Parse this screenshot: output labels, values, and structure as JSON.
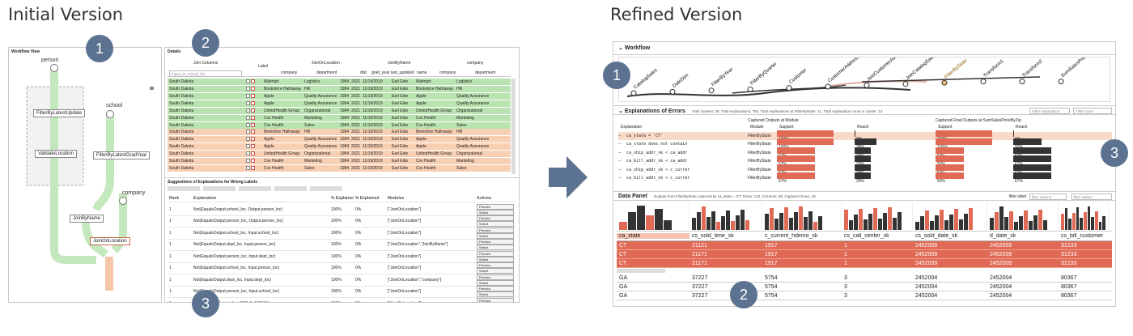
{
  "titles": {
    "initial": "Initial Version",
    "refined": "Refined Version"
  },
  "badges": {
    "w1": "1",
    "w2": "2",
    "w3": "3",
    "r1": "1",
    "r2": "2",
    "r3": "3"
  },
  "initial": {
    "workflow_view": {
      "title": "Workflow View",
      "nodes": [
        "person",
        "school",
        "company"
      ],
      "ops": [
        "FilterByLatestUpdate",
        "ValidateLocation",
        "FilterByLatestGradYear",
        "JoinByName",
        "JoinOnLocation"
      ]
    },
    "details": {
      "title": "Details",
      "header_groups": [
        "Join Columns",
        "Label",
        "JoinOnLocation",
        "JoinByName",
        "company"
      ],
      "sub_headers": [
        "company",
        "department",
        "dist",
        "grad_year",
        "last_updated",
        "name",
        "company",
        "department"
      ],
      "search_placeholder": "Input_on_school_list",
      "green_rows": [
        [
          "South Dakota",
          "Walmart",
          "Logistics",
          "1984",
          "2021",
          "11/19/2019",
          "Earl Edw",
          "Walmart",
          "Logistics"
        ],
        [
          "South Dakota",
          "Bookstore Hathaway",
          "HR",
          "1984",
          "2021",
          "11/19/2019",
          "Earl Edw",
          "Bookstore Hathaway",
          "HR"
        ],
        [
          "South Dakota",
          "Apple",
          "Quality Assurance",
          "1984",
          "2021",
          "11/19/2019",
          "Earl Edw",
          "Apple",
          "Quality Assurance"
        ],
        [
          "South Dakota",
          "Apple",
          "Quality Assurance",
          "1984",
          "2021",
          "11/19/2019",
          "Earl Edw",
          "Apple",
          "Quality Assurance"
        ],
        [
          "South Dakota",
          "UnitedHealth Group",
          "Organizational",
          "1984",
          "2021",
          "11/19/2019",
          "Earl Edw",
          "UnitedHealth Group",
          "Organizational"
        ],
        [
          "South Dakota",
          "Cvs Health",
          "Marketing",
          "1984",
          "2021",
          "11/19/2019",
          "Earl Edw",
          "Cvs Health",
          "Marketing"
        ],
        [
          "South Dakota",
          "Cvs Health",
          "Sales",
          "1984",
          "2021",
          "11/19/2019",
          "Earl Edw",
          "Cvs Health",
          "Sales"
        ]
      ],
      "orange_rows": [
        [
          "South Dakota",
          "Berkshire Hathaway",
          "HR",
          "1984",
          "2021",
          "11/19/2019",
          "Earl Edw",
          "Berkshire Hathaway",
          "HR"
        ],
        [
          "South Dakota",
          "Apple",
          "Quality Assurance",
          "1984",
          "2021",
          "11/19/2019",
          "Earl Edw",
          "Apple",
          "Quality Assurance"
        ],
        [
          "South Dakota",
          "Apple",
          "Quality Assurance",
          "1984",
          "2021",
          "11/19/2019",
          "Earl Edw",
          "Apple",
          "Quality Assurance"
        ],
        [
          "South Dakota",
          "UnitedHealth Group",
          "Organizational",
          "1984",
          "2021",
          "11/19/2019",
          "Earl Edw",
          "UnitedHealth Group",
          "Organizational"
        ],
        [
          "South Dakota",
          "Cvs Health",
          "Marketing",
          "1984",
          "2021",
          "11/19/2019",
          "Earl Edw",
          "Cvs Health",
          "Marketing"
        ],
        [
          "South Dakota",
          "Cvs Health",
          "Sales",
          "1984",
          "2021",
          "11/19/2019",
          "Earl Edw",
          "Cvs Health",
          "Sales"
        ]
      ]
    },
    "suggestions": {
      "title": "Suggestions of Explanations for Wrong Labels",
      "headers": [
        "Rank",
        "Explanation",
        "% Explained",
        "% Explained",
        "Modules",
        "Actions"
      ],
      "rows": [
        [
          "1",
          "Not(EqualsOutput.school_loc, Output.person_loc)",
          "100%",
          "0%",
          "[\"JoinOnLocation\"]"
        ],
        [
          "1",
          "Not(EqualsOutput.person_loc, Output.person_loc)",
          "100%",
          "0%",
          "[\"JoinOnLocation\"]"
        ],
        [
          "1",
          "Not(EqualsOutput.school_loc, Input.school_loc)",
          "100%",
          "0%",
          "[\"JoinOnLocation\"]"
        ],
        [
          "1",
          "Not(EqualsOutput.dept_loc, Input.person_loc)",
          "100%",
          "0%",
          "[\"JoinOnLocation\",\"JoinByName\"]"
        ],
        [
          "1",
          "Not(EqualsOutput.person_loc, Input.dept_loc)",
          "100%",
          "0%",
          "[\"JoinOnLocation\"]"
        ],
        [
          "1",
          "Not(EqualsOutput.school_loc, Input.person_loc)",
          "100%",
          "0%",
          "[\"JoinOnLocation\"]"
        ],
        [
          "1",
          "Not(EqualsOutput.dept_loc, Input.dept_loc)",
          "100%",
          "0%",
          "[\"JoinOnLocation\",\"company\"]"
        ],
        [
          "1",
          "Not(EqualsOutput.person_loc, Input.school_loc)",
          "100%",
          "0%",
          "[\"JoinOnLocation\"]"
        ],
        [
          "1",
          "Not(InRange(Output.dist, 1991.0, 1990.0))",
          "100%",
          "0%",
          "[\"JoinOnLocation\"]"
        ]
      ],
      "actions": [
        "Preview",
        "Select"
      ]
    }
  },
  "refined": {
    "workflow": {
      "title": "Workflow",
      "ops": [
        "CatalogSales",
        "DateDim",
        "FilterByYear",
        "FilterByQuarter",
        "Customer",
        "CustomerAddress",
        "JoinCustomerAddr",
        "JoinCatalogSalesCust",
        "FilterByState",
        "Transform1",
        "Transform2",
        "SumSalesPriceByZip"
      ]
    },
    "errors": {
      "title": "Explanations of Errors",
      "summary": "Total clusters: 35, Total explanations: 705, Total explanations at FilterByState: 21, Total explanation count in cluster: 13",
      "filter_placeholder": "Filter explanation",
      "filter_score_placeholder": "Filter score",
      "group1": "Captured Outputs at Module",
      "group2": "Captured Final Outputs at SumSalesPriceByZip",
      "cols": [
        "Explanation",
        "Module",
        "Support",
        "Reach",
        "Support",
        "Reach"
      ],
      "rows": [
        {
          "exp": "ca_state = 'CT'",
          "module": "FilterByState",
          "s1": "100%",
          "s1v": 1.0,
          "r1": "0%",
          "r1v": 0.0,
          "s2": "100%",
          "s2v": 1.0,
          "r2": "0%",
          "r2v": 0.0,
          "hl": true
        },
        {
          "exp": "ca_state does not contain",
          "module": "FilterByState",
          "s1": "100%",
          "s1v": 1.0,
          "r1": "38%",
          "r1v": 0.38,
          "s2": "100%",
          "s2v": 1.0,
          "r2": "50%",
          "r2v": 0.5,
          "hl": false
        },
        {
          "exp": "ca_ship_addr_sk < ca_addr",
          "module": "FilterByState",
          "s1": "67%",
          "s1v": 0.67,
          "r1": "29%",
          "r1v": 0.29,
          "s2": "50%",
          "s2v": 0.5,
          "r2": "67%",
          "r2v": 0.67,
          "hl": false
        },
        {
          "exp": "ca_bill_addr_sk < ca_addr",
          "module": "FilterByState",
          "s1": "67%",
          "s1v": 0.67,
          "r1": "29%",
          "r1v": 0.29,
          "s2": "50%",
          "s2v": 0.5,
          "r2": "67%",
          "r2v": 0.67,
          "hl": false
        },
        {
          "exp": "ca_ship_addr_sk < c_currer",
          "module": "FilterByState",
          "s1": "67%",
          "s1v": 0.67,
          "r1": "29%",
          "r1v": 0.29,
          "s2": "50%",
          "s2v": 0.5,
          "r2": "67%",
          "r2v": 0.67,
          "hl": false
        },
        {
          "exp": "ca_bill_addr_sk < c_currer",
          "module": "FilterByState",
          "s1": "67%",
          "s1v": 0.67,
          "r1": "29%",
          "r1v": 0.29,
          "s2": "50%",
          "s2v": 0.5,
          "r2": "67%",
          "r2v": 0.67,
          "hl": false
        }
      ]
    },
    "data_panel": {
      "title": "Data Panel",
      "summary": "Outputs from FilterByState captured by  ca_state = 'CT'    Rows: 143, Columns: 58, Captured Rows: 46",
      "filter_label": "filter label",
      "filter_column": "filter column",
      "filter_values": "filter values",
      "columns": [
        "ca_state",
        "cs_sold_time_sk",
        "c_current_hdemo_sk",
        "cs_call_center_sk",
        "cs_sold_date_sk",
        "d_date_sk",
        "cs_bill_customer"
      ],
      "captured_rows": [
        [
          "CT",
          "21121",
          "1917",
          "1",
          "2452009",
          "2452009",
          "31233"
        ],
        [
          "CT",
          "21171",
          "1917",
          "1",
          "2452009",
          "2452009",
          "31233"
        ],
        [
          "CT",
          "21171",
          "1917",
          "1",
          "2452009",
          "2452009",
          "31233"
        ]
      ],
      "rows": [
        [
          "GA",
          "37227",
          "5754",
          "3",
          "2452004",
          "2452004",
          "80367"
        ],
        [
          "GA",
          "37227",
          "5754",
          "3",
          "2452004",
          "2452004",
          "80367"
        ],
        [
          "GA",
          "37227",
          "5754",
          "3",
          "2452004",
          "2452004",
          "80367"
        ]
      ]
    }
  },
  "colors": {
    "accent": "#5b7290",
    "green": "#b9e3b0",
    "orange": "#f7cfb2",
    "red": "#e06a55",
    "bar": "#333333"
  }
}
